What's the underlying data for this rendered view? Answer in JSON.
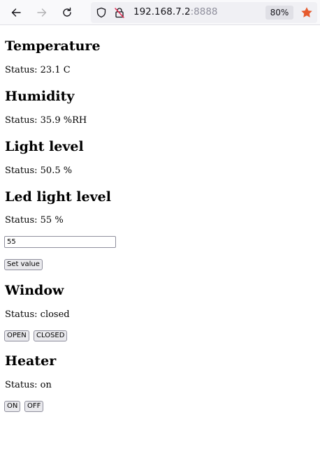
{
  "browser": {
    "url_host": "192.168.7.2",
    "url_port": ":8888",
    "zoom": "80%",
    "icons": [
      "back-arrow-icon",
      "forward-arrow-icon",
      "reload-icon",
      "shield-icon",
      "insecure-lock-icon",
      "bookmark-star-icon"
    ],
    "colors": {
      "star": "#e65b2e",
      "toolbar_bg": "#f9f9fb",
      "urlbar_bg": "#f0f0f4"
    }
  },
  "temperature": {
    "title": "Temperature",
    "status": "Status: 23.1 C"
  },
  "humidity": {
    "title": "Humidity",
    "status": "Status: 35.9 %RH"
  },
  "light": {
    "title": "Light level",
    "status": "Status: 50.5 %"
  },
  "led": {
    "title": "Led light level",
    "status": "Status: 55 %",
    "input_value": "55",
    "set_label": "Set value"
  },
  "window": {
    "title": "Window",
    "status": "Status: closed",
    "open_label": "OPEN",
    "closed_label": "CLOSED"
  },
  "heater": {
    "title": "Heater",
    "status": "Status: on",
    "on_label": "ON",
    "off_label": "OFF"
  }
}
